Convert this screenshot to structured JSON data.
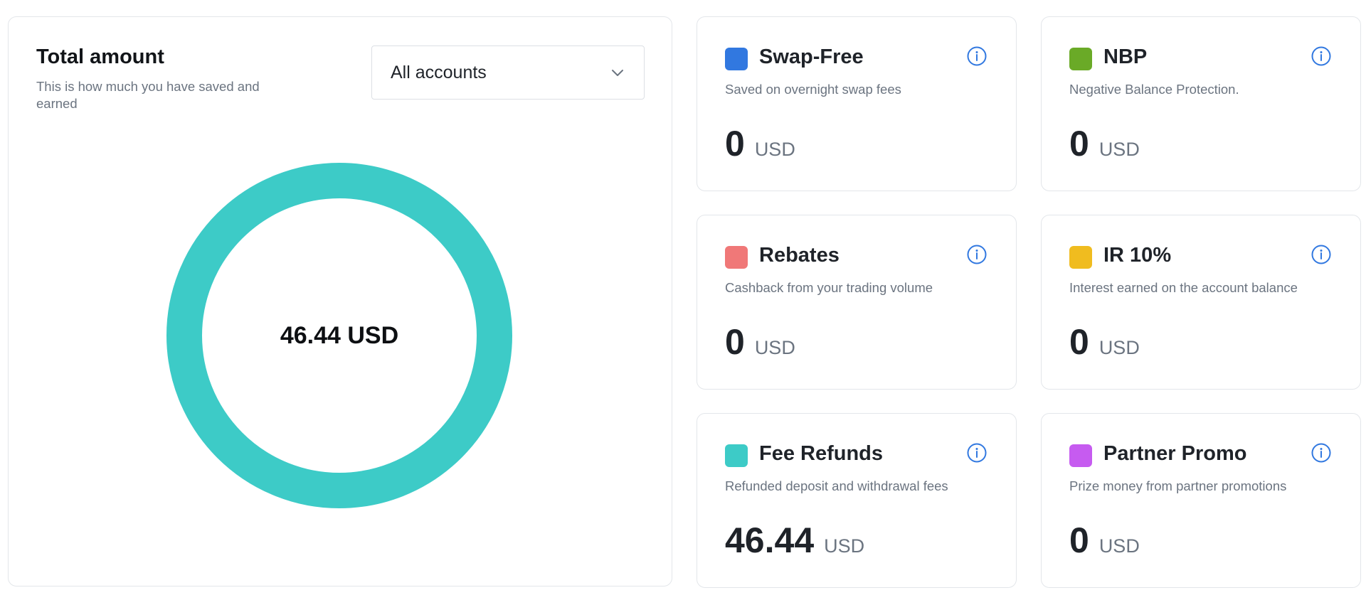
{
  "total": {
    "title": "Total amount",
    "subtitle": "This is how much you have saved and earned",
    "account_select": {
      "value": "All accounts"
    },
    "donut_label": "46.44 USD"
  },
  "chart_data": {
    "type": "pie",
    "slices": [
      {
        "name": "Swap-Free",
        "value": 0,
        "color": "#3178e0"
      },
      {
        "name": "NBP",
        "value": 0,
        "color": "#6aaa27"
      },
      {
        "name": "Rebates",
        "value": 0,
        "color": "#f07878"
      },
      {
        "name": "IR 10%",
        "value": 0,
        "color": "#f0bc1f"
      },
      {
        "name": "Fee Refunds",
        "value": 46.44,
        "color": "#3dcbc7"
      },
      {
        "name": "Partner Promo",
        "value": 0,
        "color": "#c65bf0"
      }
    ],
    "title": "",
    "center_label": "46.44 USD"
  },
  "cards": [
    {
      "title": "Swap-Free",
      "description": "Saved on overnight swap fees",
      "amount": "0",
      "currency": "USD",
      "color": "#3178e0"
    },
    {
      "title": "NBP",
      "description": "Negative Balance Protection.",
      "amount": "0",
      "currency": "USD",
      "color": "#6aaa27"
    },
    {
      "title": "Rebates",
      "description": "Cashback from your trading volume",
      "amount": "0",
      "currency": "USD",
      "color": "#f07878"
    },
    {
      "title": "IR 10%",
      "description": "Interest earned on the account balance",
      "amount": "0",
      "currency": "USD",
      "color": "#f0bc1f"
    },
    {
      "title": "Fee Refunds",
      "description": "Refunded deposit and withdrawal fees",
      "amount": "46.44",
      "currency": "USD",
      "color": "#3dcbc7"
    },
    {
      "title": "Partner Promo",
      "description": "Prize money from partner promotions",
      "amount": "0",
      "currency": "USD",
      "color": "#c65bf0"
    }
  ],
  "colors": {
    "info_icon": "#3178e0",
    "border": "#e3e6ea"
  }
}
